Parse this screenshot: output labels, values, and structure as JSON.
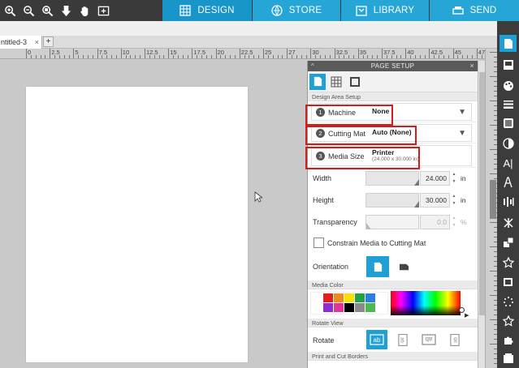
{
  "nav": {
    "tabs": [
      {
        "label": "DESIGN",
        "icon": "grid-icon",
        "active": true
      },
      {
        "label": "STORE",
        "icon": "store-icon",
        "active": false
      },
      {
        "label": "LIBRARY",
        "icon": "library-icon",
        "active": false
      },
      {
        "label": "SEND",
        "icon": "send-icon",
        "active": false
      }
    ],
    "tools": [
      "zoom-in-icon",
      "zoom-out-icon",
      "zoom-fit-icon",
      "move-down-icon",
      "pan-hand-icon",
      "add-frame-icon"
    ]
  },
  "document": {
    "tab_label": "ntitled-3",
    "close": "×",
    "add": "+"
  },
  "ruler": {
    "labels": [
      "0",
      "2.5",
      "5",
      "7.5",
      "10",
      "12.5",
      "15",
      "17.5",
      "20",
      "22.5",
      "25",
      "27",
      "30",
      "32.5",
      "35",
      "37.5",
      "40",
      "42.5",
      "45",
      "47.5"
    ]
  },
  "panel": {
    "title": "PAGE SETUP",
    "collapse": "^",
    "close": "×",
    "section_design_area": "Design Area Setup",
    "machine": {
      "num": "1",
      "label": "Machine",
      "value": "None"
    },
    "cutting_mat": {
      "num": "2",
      "label": "Cutting Mat",
      "value": "Auto (None)"
    },
    "media_size": {
      "num": "3",
      "label": "Media Size",
      "value": "Printer",
      "sub": "(24.000 x 30.000 in)"
    },
    "width": {
      "label": "Width",
      "value": "24.000",
      "unit": "in"
    },
    "height": {
      "label": "Height",
      "value": "30.000",
      "unit": "in"
    },
    "transparency": {
      "label": "Transparency",
      "value": "0.0",
      "unit": "%"
    },
    "constrain": {
      "label": "Constrain Media to Cutting Mat",
      "checked": false
    },
    "orientation": {
      "label": "Orientation",
      "selected": "portrait"
    },
    "section_media_color": "Media Color",
    "swatches": [
      "#ffffff",
      "#e02020",
      "#f08c1e",
      "#f5e100",
      "#23a046",
      "#2a7fd9",
      "#ffffff",
      "#ffffff",
      "#8a2fd0",
      "#e0359a",
      "#000000",
      "#8a8a8a",
      "#4db850",
      "#ffffff"
    ],
    "section_rotate": "Rotate View",
    "rotate": {
      "label": "Rotate",
      "options": [
        "ab",
        "ab",
        "ab",
        "ab"
      ],
      "selected": 0
    },
    "section_print_cut": "Print and Cut Borders"
  },
  "colors": {
    "accent": "#1ea0d6",
    "highlight": "#d21d1d",
    "topbar": "#3a3a3a"
  }
}
